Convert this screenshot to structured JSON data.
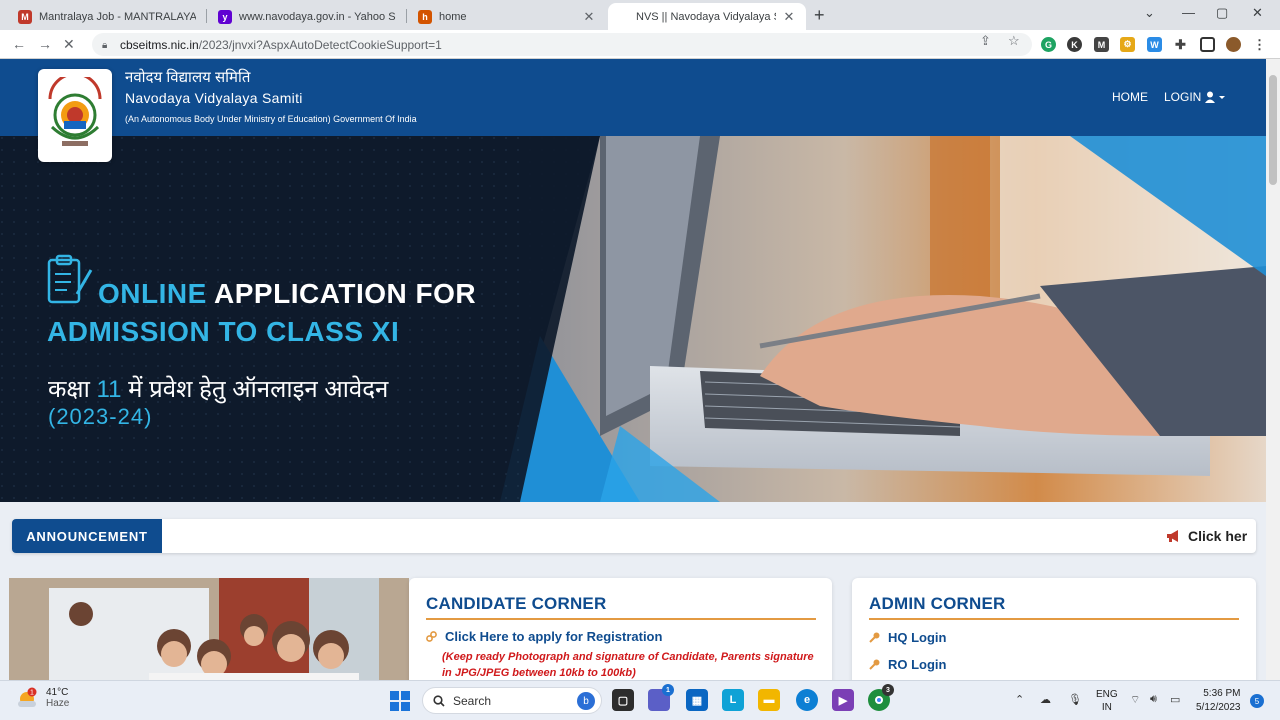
{
  "browser": {
    "tabs": [
      {
        "title": "Mantralaya Job - MANTRALAYA",
        "fav_color": "#c0392b"
      },
      {
        "title": "www.navodaya.gov.in - Yahoo Se",
        "fav_color": "#6001d2"
      },
      {
        "title": "home",
        "fav_color": "#d35400"
      },
      {
        "title": "NVS || Navodaya Vidyalaya Samiti",
        "fav_color": "#ffffff"
      }
    ],
    "url_host": "cbseitms.nic.in",
    "url_rest": "/2023/jnvxi?AspxAutoDetectCookieSupport=1",
    "extensions": [
      {
        "label": "G",
        "color": "#1ea362"
      },
      {
        "label": "K",
        "color": "#3a3a3a"
      },
      {
        "label": "M",
        "color": "#444444"
      },
      {
        "label": "⚙",
        "color": "#e6a817"
      },
      {
        "label": "W",
        "color": "#2b8ce6"
      }
    ]
  },
  "site": {
    "org_hindi": "नवोदय विद्यालय समिति",
    "org_english": "Navodaya Vidyalaya Samiti",
    "org_sub": "(An Autonomous Body Under Ministry of Education) Government Of India",
    "nav_home": "HOME",
    "nav_login": "LOGIN"
  },
  "banner": {
    "line1_highlight": "ONLINE",
    "line1_rest": " APPLICATION FOR",
    "line2": "ADMISSION TO CLASS XI",
    "line3_pre": "कक्षा ",
    "line3_num": "11",
    "line3_post": " में प्रवेश हेतु ऑनलाइन आवेदन",
    "line4": "(2023-24)"
  },
  "announcement": {
    "label": "ANNOUNCEMENT",
    "marquee": "Click her"
  },
  "candidate_corner": {
    "title": "CANDIDATE CORNER",
    "link": "Click Here to apply for Registration",
    "note": "(Keep ready Photograph and signature of Candidate, Parents signature in JPG/JPEG between 10kb to 100kb)"
  },
  "admin_corner": {
    "title": "ADMIN CORNER",
    "links": [
      "HQ Login",
      "RO Login"
    ]
  },
  "taskbar": {
    "temp": "41°C",
    "weather": "Haze",
    "search": "Search",
    "lang1": "ENG",
    "lang2": "IN",
    "time": "5:36 PM",
    "date": "5/12/2023",
    "notif_count": "5",
    "weather_badge": "1",
    "chat_badge": "1",
    "chrome_badge": "3"
  }
}
